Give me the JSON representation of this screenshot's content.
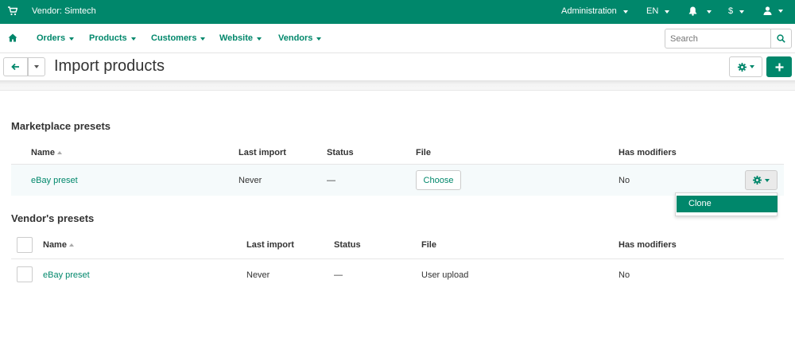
{
  "topbar": {
    "vendor_label": "Vendor: Simtech",
    "administration": "Administration",
    "language": "EN",
    "currency": "$",
    "icons": [
      "cart-icon",
      "bell-icon",
      "user-icon"
    ]
  },
  "nav": {
    "items": [
      "Orders",
      "Products",
      "Customers",
      "Website",
      "Vendors"
    ],
    "search_placeholder": "Search"
  },
  "page": {
    "title": "Import products"
  },
  "marketplace": {
    "title": "Marketplace presets",
    "headers": {
      "name": "Name",
      "last_import": "Last import",
      "status": "Status",
      "file": "File",
      "has_modifiers": "Has modifiers"
    },
    "row": {
      "name": "eBay preset",
      "last_import": "Never",
      "status": "—",
      "file_button": "Choose",
      "has_modifiers": "No"
    },
    "dropdown": {
      "clone": "Clone"
    }
  },
  "vendor": {
    "title": "Vendor's presets",
    "headers": {
      "name": "Name",
      "last_import": "Last import",
      "status": "Status",
      "file": "File",
      "has_modifiers": "Has modifiers"
    },
    "row": {
      "name": "eBay preset",
      "last_import": "Never",
      "status": "—",
      "file": "User upload",
      "has_modifiers": "No"
    }
  },
  "colors": {
    "brand": "#00876b",
    "row_highlight": "#f5fafb"
  }
}
